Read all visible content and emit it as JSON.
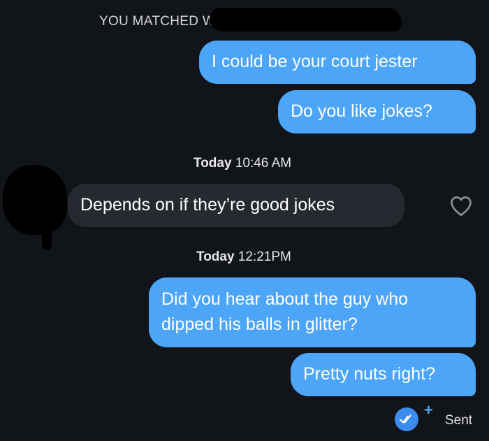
{
  "header": {
    "matched_text": "YOU MATCHED WI"
  },
  "messages": [
    {
      "text": "I could be your court jester",
      "direction": "sent"
    },
    {
      "text": "Do you like jokes?",
      "direction": "sent"
    },
    {
      "text": "Depends on if they’re good jokes",
      "direction": "received"
    },
    {
      "text": "Did you hear about the guy who dipped his balls in glitter?",
      "direction": "sent"
    },
    {
      "text": "Pretty nuts right?",
      "direction": "sent"
    }
  ],
  "timestamps": [
    {
      "day": "Today",
      "time": "10:46 AM"
    },
    {
      "day": "Today",
      "time": "12:21PM"
    }
  ],
  "status": {
    "sent_label": "Sent",
    "plus_symbol": "+"
  },
  "icons": {
    "heart": "heart-outline-icon",
    "read_receipt": "double-check-icon",
    "boost": "plus-icon"
  },
  "colors": {
    "background": "#111418",
    "sent_bubble": "#4da5f7",
    "received_bubble": "#262a30",
    "receipt_badge": "#3c8cf0"
  }
}
